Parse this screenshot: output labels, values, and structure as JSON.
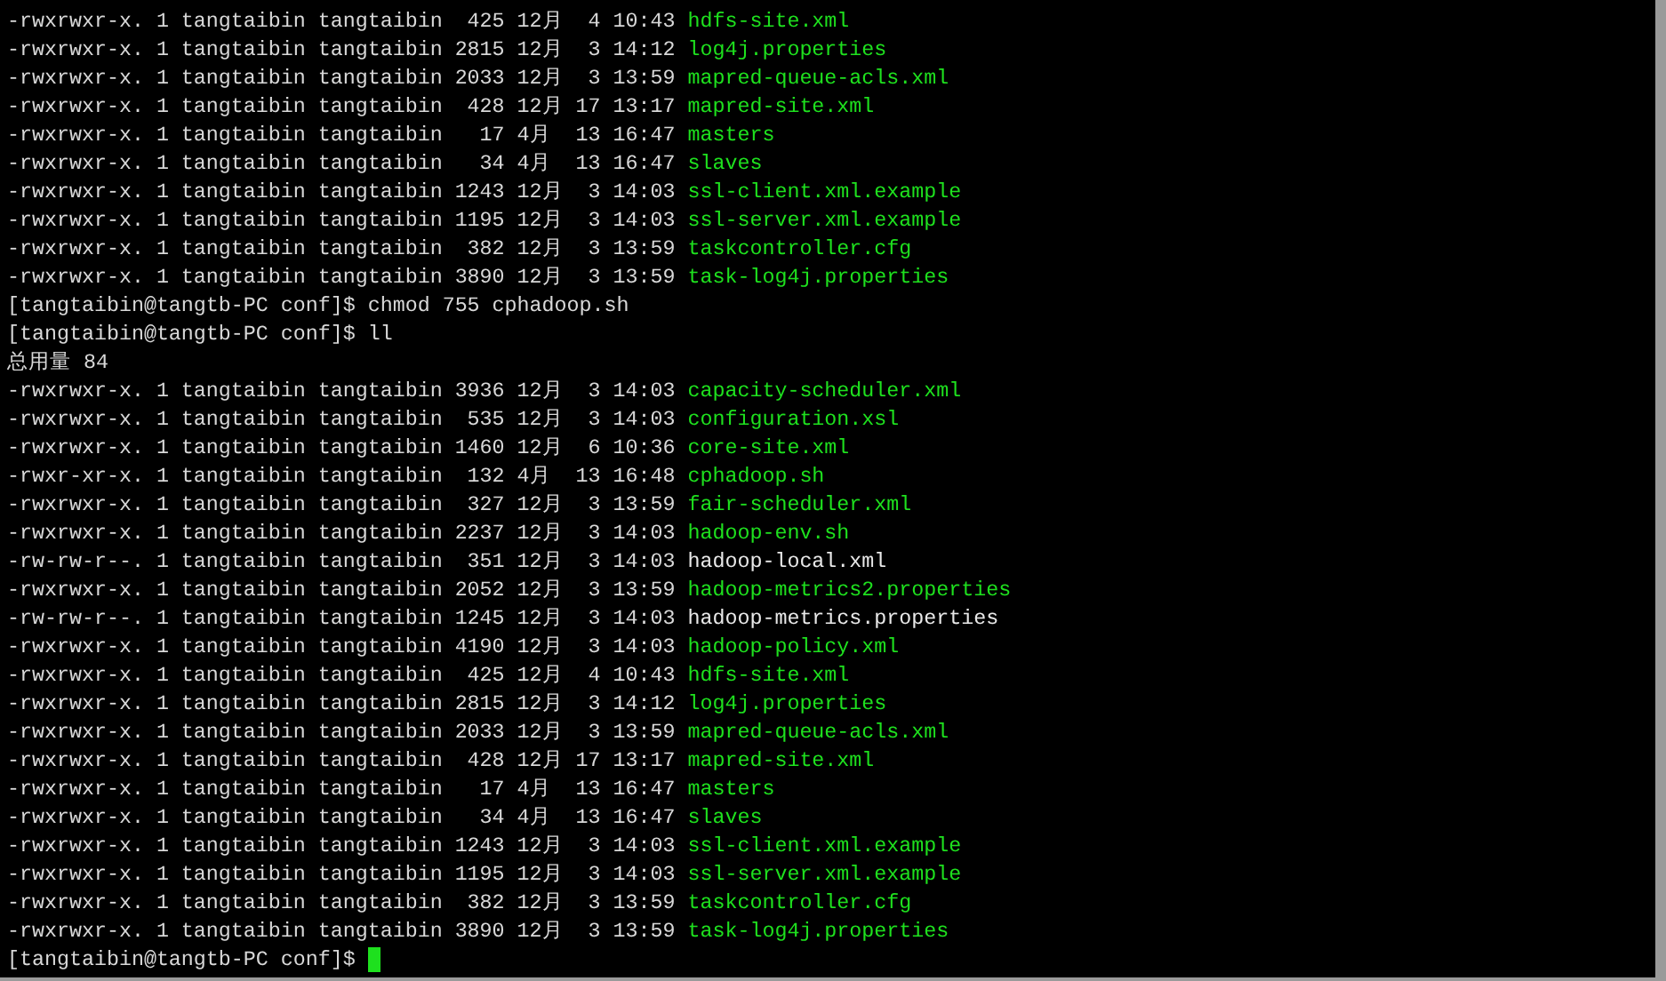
{
  "terminal": {
    "lines": [
      {
        "kind": "listing",
        "info": "-rwxrwxr-x. 1 tangtaibin tangtaibin  425 12月  4 10:43 ",
        "name": "hdfs-site.xml",
        "executable": true
      },
      {
        "kind": "listing",
        "info": "-rwxrwxr-x. 1 tangtaibin tangtaibin 2815 12月  3 14:12 ",
        "name": "log4j.properties",
        "executable": true
      },
      {
        "kind": "listing",
        "info": "-rwxrwxr-x. 1 tangtaibin tangtaibin 2033 12月  3 13:59 ",
        "name": "mapred-queue-acls.xml",
        "executable": true
      },
      {
        "kind": "listing",
        "info": "-rwxrwxr-x. 1 tangtaibin tangtaibin  428 12月 17 13:17 ",
        "name": "mapred-site.xml",
        "executable": true
      },
      {
        "kind": "listing",
        "info": "-rwxrwxr-x. 1 tangtaibin tangtaibin   17 4月  13 16:47 ",
        "name": "masters",
        "executable": true
      },
      {
        "kind": "listing",
        "info": "-rwxrwxr-x. 1 tangtaibin tangtaibin   34 4月  13 16:47 ",
        "name": "slaves",
        "executable": true
      },
      {
        "kind": "listing",
        "info": "-rwxrwxr-x. 1 tangtaibin tangtaibin 1243 12月  3 14:03 ",
        "name": "ssl-client.xml.example",
        "executable": true
      },
      {
        "kind": "listing",
        "info": "-rwxrwxr-x. 1 tangtaibin tangtaibin 1195 12月  3 14:03 ",
        "name": "ssl-server.xml.example",
        "executable": true
      },
      {
        "kind": "listing",
        "info": "-rwxrwxr-x. 1 tangtaibin tangtaibin  382 12月  3 13:59 ",
        "name": "taskcontroller.cfg",
        "executable": true
      },
      {
        "kind": "listing",
        "info": "-rwxrwxr-x. 1 tangtaibin tangtaibin 3890 12月  3 13:59 ",
        "name": "task-log4j.properties",
        "executable": true
      },
      {
        "kind": "prompt",
        "text": "[tangtaibin@tangtb-PC conf]$ chmod 755 cphadoop.sh",
        "cursor": false
      },
      {
        "kind": "prompt",
        "text": "[tangtaibin@tangtb-PC conf]$ ll",
        "cursor": false
      },
      {
        "kind": "text",
        "text": "总用量 84"
      },
      {
        "kind": "listing",
        "info": "-rwxrwxr-x. 1 tangtaibin tangtaibin 3936 12月  3 14:03 ",
        "name": "capacity-scheduler.xml",
        "executable": true
      },
      {
        "kind": "listing",
        "info": "-rwxrwxr-x. 1 tangtaibin tangtaibin  535 12月  3 14:03 ",
        "name": "configuration.xsl",
        "executable": true
      },
      {
        "kind": "listing",
        "info": "-rwxrwxr-x. 1 tangtaibin tangtaibin 1460 12月  6 10:36 ",
        "name": "core-site.xml",
        "executable": true
      },
      {
        "kind": "listing",
        "info": "-rwxr-xr-x. 1 tangtaibin tangtaibin  132 4月  13 16:48 ",
        "name": "cphadoop.sh",
        "executable": true
      },
      {
        "kind": "listing",
        "info": "-rwxrwxr-x. 1 tangtaibin tangtaibin  327 12月  3 13:59 ",
        "name": "fair-scheduler.xml",
        "executable": true
      },
      {
        "kind": "listing",
        "info": "-rwxrwxr-x. 1 tangtaibin tangtaibin 2237 12月  3 14:03 ",
        "name": "hadoop-env.sh",
        "executable": true
      },
      {
        "kind": "listing",
        "info": "-rw-rw-r--. 1 tangtaibin tangtaibin  351 12月  3 14:03 ",
        "name": "hadoop-local.xml",
        "executable": false
      },
      {
        "kind": "listing",
        "info": "-rwxrwxr-x. 1 tangtaibin tangtaibin 2052 12月  3 13:59 ",
        "name": "hadoop-metrics2.properties",
        "executable": true
      },
      {
        "kind": "listing",
        "info": "-rw-rw-r--. 1 tangtaibin tangtaibin 1245 12月  3 14:03 ",
        "name": "hadoop-metrics.properties",
        "executable": false
      },
      {
        "kind": "listing",
        "info": "-rwxrwxr-x. 1 tangtaibin tangtaibin 4190 12月  3 14:03 ",
        "name": "hadoop-policy.xml",
        "executable": true
      },
      {
        "kind": "listing",
        "info": "-rwxrwxr-x. 1 tangtaibin tangtaibin  425 12月  4 10:43 ",
        "name": "hdfs-site.xml",
        "executable": true
      },
      {
        "kind": "listing",
        "info": "-rwxrwxr-x. 1 tangtaibin tangtaibin 2815 12月  3 14:12 ",
        "name": "log4j.properties",
        "executable": true
      },
      {
        "kind": "listing",
        "info": "-rwxrwxr-x. 1 tangtaibin tangtaibin 2033 12月  3 13:59 ",
        "name": "mapred-queue-acls.xml",
        "executable": true
      },
      {
        "kind": "listing",
        "info": "-rwxrwxr-x. 1 tangtaibin tangtaibin  428 12月 17 13:17 ",
        "name": "mapred-site.xml",
        "executable": true
      },
      {
        "kind": "listing",
        "info": "-rwxrwxr-x. 1 tangtaibin tangtaibin   17 4月  13 16:47 ",
        "name": "masters",
        "executable": true
      },
      {
        "kind": "listing",
        "info": "-rwxrwxr-x. 1 tangtaibin tangtaibin   34 4月  13 16:47 ",
        "name": "slaves",
        "executable": true
      },
      {
        "kind": "listing",
        "info": "-rwxrwxr-x. 1 tangtaibin tangtaibin 1243 12月  3 14:03 ",
        "name": "ssl-client.xml.example",
        "executable": true
      },
      {
        "kind": "listing",
        "info": "-rwxrwxr-x. 1 tangtaibin tangtaibin 1195 12月  3 14:03 ",
        "name": "ssl-server.xml.example",
        "executable": true
      },
      {
        "kind": "listing",
        "info": "-rwxrwxr-x. 1 tangtaibin tangtaibin  382 12月  3 13:59 ",
        "name": "taskcontroller.cfg",
        "executable": true
      },
      {
        "kind": "listing",
        "info": "-rwxrwxr-x. 1 tangtaibin tangtaibin 3890 12月  3 13:59 ",
        "name": "task-log4j.properties",
        "executable": true
      },
      {
        "kind": "prompt",
        "text": "[tangtaibin@tangtb-PC conf]$",
        "cursor": true
      }
    ]
  }
}
